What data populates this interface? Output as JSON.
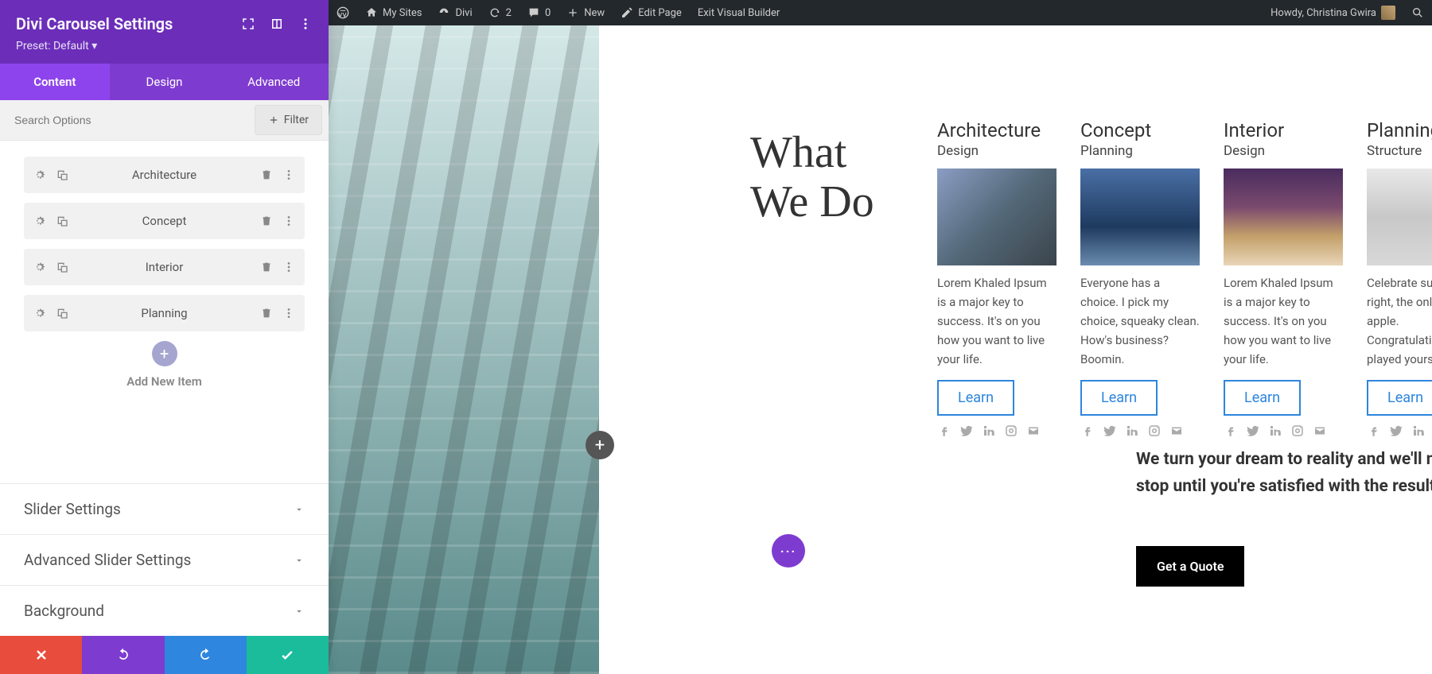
{
  "panel": {
    "title": "Divi Carousel Settings",
    "preset": "Preset: Default ▾",
    "tabs": {
      "content": "Content",
      "design": "Design",
      "advanced": "Advanced"
    },
    "searchPlaceholder": "Search Options",
    "filterLabel": "Filter",
    "items": [
      {
        "label": "Architecture"
      },
      {
        "label": "Concept"
      },
      {
        "label": "Interior"
      },
      {
        "label": "Planning"
      }
    ],
    "addLabel": "Add New Item",
    "accordions": [
      {
        "title": "Slider Settings"
      },
      {
        "title": "Advanced Slider Settings"
      },
      {
        "title": "Background"
      }
    ]
  },
  "adminBar": {
    "mySites": "My Sites",
    "siteName": "Divi",
    "updates": "2",
    "comments": "0",
    "new": "New",
    "editPage": "Edit Page",
    "exitBuilder": "Exit Visual Builder",
    "greeting": "Howdy, Christina Gwira"
  },
  "preview": {
    "heroText": "What\nWe Do",
    "cards": [
      {
        "title": "Architecture",
        "sub": "Design",
        "desc": "Lorem Khaled Ipsum is a major key to success. It's on you how you want to live your life.",
        "btn": "Learn"
      },
      {
        "title": "Concept",
        "sub": "Planning",
        "desc": "Everyone has a choice. I pick my choice, squeaky clean. How's business? Boomin.",
        "btn": "Learn"
      },
      {
        "title": "Interior",
        "sub": "Design",
        "desc": "Lorem Khaled Ipsum is a major key to success. It's on you how you want to live your life.",
        "btn": "Learn"
      },
      {
        "title": "Planning",
        "sub": "Structure",
        "desc": "Celebrate success right, the only way, apple. Congratulations, you played yourself.",
        "btn": "Learn"
      }
    ],
    "dreamText": "We turn your dream to reality and we'll never stop until you're satisfied with the result",
    "quoteBtn": "Get a Quote"
  }
}
